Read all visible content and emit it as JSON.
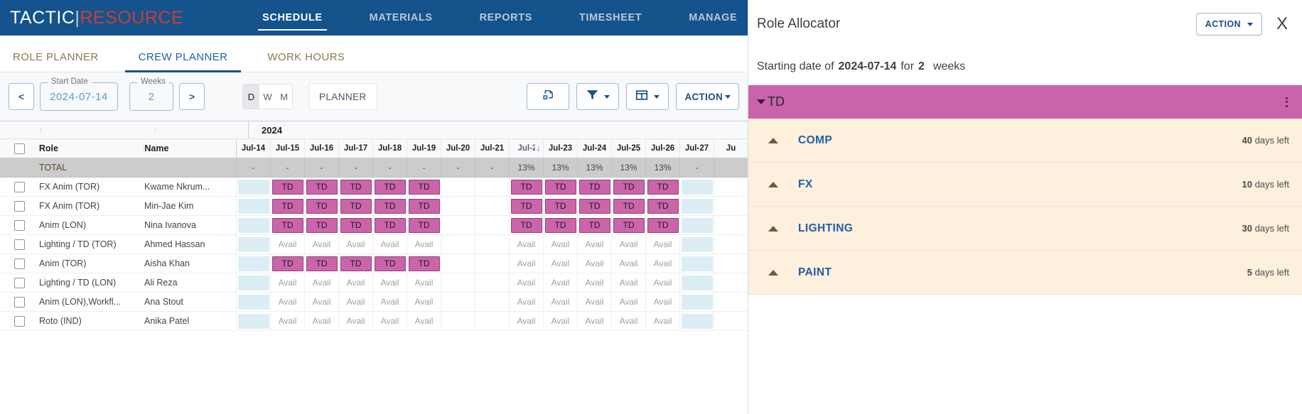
{
  "brand": {
    "part1": "TACTIC",
    "divider": "|",
    "part2": "RESOURCE"
  },
  "topnav": {
    "items": [
      {
        "label": "SCHEDULE",
        "active": true
      },
      {
        "label": "MATERIALS",
        "active": false
      },
      {
        "label": "REPORTS",
        "active": false
      },
      {
        "label": "TIMESHEET",
        "active": false
      },
      {
        "label": "MANAGE",
        "active": false
      }
    ]
  },
  "subtabs": {
    "items": [
      {
        "label": "ROLE PLANNER",
        "active": false
      },
      {
        "label": "CREW PLANNER",
        "active": true
      },
      {
        "label": "WORK HOURS",
        "active": false
      }
    ]
  },
  "toolbar": {
    "prev_label": "<",
    "next_label": ">",
    "start_date_label": "Start Date",
    "start_date_value": "2024-07-14",
    "weeks_label": "Weeks",
    "weeks_value": "2",
    "dwm": [
      {
        "label": "D",
        "selected": true
      },
      {
        "label": "W",
        "selected": false
      },
      {
        "label": "M",
        "selected": false
      }
    ],
    "planner_label": "PLANNER",
    "export_icon": "save-export-icon",
    "filter_icon": "filter-funnel-icon",
    "columns_icon": "columns-layout-icon",
    "action_label": "ACTION"
  },
  "grid": {
    "year": "2024",
    "columns": {
      "role": "Role",
      "name": "Name"
    },
    "dates": [
      {
        "label": "Jul-14",
        "sorted": false
      },
      {
        "label": "Jul-15",
        "sorted": false
      },
      {
        "label": "Jul-16",
        "sorted": false
      },
      {
        "label": "Jul-17",
        "sorted": false
      },
      {
        "label": "Jul-18",
        "sorted": false
      },
      {
        "label": "Jul-19",
        "sorted": false
      },
      {
        "label": "Jul-20",
        "sorted": false
      },
      {
        "label": "Jul-21",
        "sorted": false
      },
      {
        "label": "Jul-22",
        "sorted": true
      },
      {
        "label": "Jul-23",
        "sorted": false
      },
      {
        "label": "Jul-24",
        "sorted": false
      },
      {
        "label": "Jul-25",
        "sorted": false
      },
      {
        "label": "Jul-26",
        "sorted": false
      },
      {
        "label": "Jul-27",
        "sorted": false
      },
      {
        "label": "Ju",
        "sorted": false
      }
    ],
    "total_row": {
      "label": "TOTAL",
      "values": [
        "-",
        "-",
        "-",
        "-",
        "-",
        "-",
        "-",
        "-",
        "13%",
        "13%",
        "13%",
        "13%",
        "13%",
        "-",
        ""
      ]
    },
    "rows": [
      {
        "role": "FX Anim (TOR)",
        "name": "Kwame Nkrum...",
        "cells": [
          "blank",
          "td",
          "td",
          "td",
          "td",
          "td",
          "empty",
          "empty",
          "td",
          "td",
          "td",
          "td",
          "td",
          "blank",
          ""
        ]
      },
      {
        "role": "FX Anim (TOR)",
        "name": "Min-Jae Kim",
        "cells": [
          "blank",
          "td",
          "td",
          "td",
          "td",
          "td",
          "empty",
          "empty",
          "td",
          "td",
          "td",
          "td",
          "td",
          "blank",
          ""
        ]
      },
      {
        "role": "Anim (LON)",
        "name": "Nina Ivanova",
        "cells": [
          "blank",
          "td",
          "td",
          "td",
          "td",
          "td",
          "empty",
          "empty",
          "td",
          "td",
          "td",
          "td",
          "td",
          "blank",
          ""
        ]
      },
      {
        "role": "Lighting / TD (TOR)",
        "name": "Ahmed Hassan",
        "cells": [
          "blank",
          "avail",
          "avail",
          "avail",
          "avail",
          "avail",
          "empty",
          "empty",
          "avail",
          "avail",
          "avail",
          "avail",
          "avail",
          "blank",
          ""
        ]
      },
      {
        "role": "Anim (TOR)",
        "name": "Aisha Khan",
        "cells": [
          "blank",
          "td",
          "td",
          "td",
          "td",
          "td",
          "empty",
          "empty",
          "avail",
          "avail",
          "avail",
          "avail",
          "avail",
          "blank",
          ""
        ]
      },
      {
        "role": "Lighting / TD (LON)",
        "name": "Ali Reza",
        "cells": [
          "blank",
          "avail",
          "avail",
          "avail",
          "avail",
          "avail",
          "empty",
          "empty",
          "avail",
          "avail",
          "avail",
          "avail",
          "avail",
          "blank",
          ""
        ]
      },
      {
        "role": "Anim (LON),Workfl...",
        "name": "Ana Stout",
        "cells": [
          "blank",
          "avail",
          "avail",
          "avail",
          "avail",
          "avail",
          "empty",
          "empty",
          "avail",
          "avail",
          "avail",
          "avail",
          "avail",
          "blank",
          ""
        ]
      },
      {
        "role": "Roto (IND)",
        "name": "Anika Patel",
        "cells": [
          "blank",
          "avail",
          "avail",
          "avail",
          "avail",
          "avail",
          "empty",
          "empty",
          "avail",
          "avail",
          "avail",
          "avail",
          "avail",
          "blank",
          ""
        ]
      }
    ],
    "cell_td_label": "TD",
    "cell_avail_label": "Avail"
  },
  "panel": {
    "title": "Role Allocator",
    "action_label": "ACTION",
    "close_label": "X",
    "sub_prefix": "Starting date of",
    "sub_date": "2024-07-14",
    "sub_mid": "for",
    "sub_weeks": "2",
    "sub_suffix": "weeks",
    "group": {
      "name": "TD",
      "color": "#c963ac"
    },
    "roles": [
      {
        "name": "COMP",
        "days": "40",
        "days_suffix": "days left"
      },
      {
        "name": "FX",
        "days": "10",
        "days_suffix": "days left"
      },
      {
        "name": "LIGHTING",
        "days": "30",
        "days_suffix": "days left"
      },
      {
        "name": "PAINT",
        "days": "5",
        "days_suffix": "days left"
      }
    ]
  },
  "colors": {
    "nav_blue": "#14538c",
    "td_chip": "#cc64ab",
    "avail_blue": "#dceef5",
    "group_magenta": "#c963ac",
    "role_row_cream": "#fdf0dd",
    "accent_link": "#1f5fa8"
  }
}
